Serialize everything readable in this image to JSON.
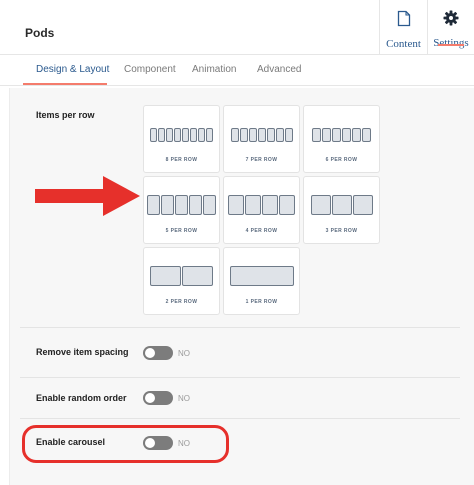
{
  "header": {
    "title": "Pods",
    "content_label": "Content",
    "settings_label": "Settings"
  },
  "tabs": [
    {
      "label": "Design & Layout",
      "active": true
    },
    {
      "label": "Component",
      "active": false
    },
    {
      "label": "Animation",
      "active": false
    },
    {
      "label": "Advanced",
      "active": false
    }
  ],
  "items_per_row": {
    "label": "Items per row",
    "options": [
      {
        "label": "8 PER ROW",
        "count": 8
      },
      {
        "label": "7 PER ROW",
        "count": 7
      },
      {
        "label": "6 PER ROW",
        "count": 6
      },
      {
        "label": "5 PER ROW",
        "count": 5
      },
      {
        "label": "4 PER ROW",
        "count": 4
      },
      {
        "label": "3 PER ROW",
        "count": 3
      },
      {
        "label": "2 PER ROW",
        "count": 2
      },
      {
        "label": "1 PER ROW",
        "count": 1
      }
    ]
  },
  "settings": [
    {
      "label": "Remove item spacing",
      "value": "NO",
      "on": false
    },
    {
      "label": "Enable random order",
      "value": "NO",
      "on": false
    },
    {
      "label": "Enable carousel",
      "value": "NO",
      "on": false
    }
  ],
  "colors": {
    "accent": "#2b5a8e",
    "tab_underline": "#f47c6c",
    "annotation_red": "#e6302b",
    "toggle_off": "#7c7c7c"
  }
}
